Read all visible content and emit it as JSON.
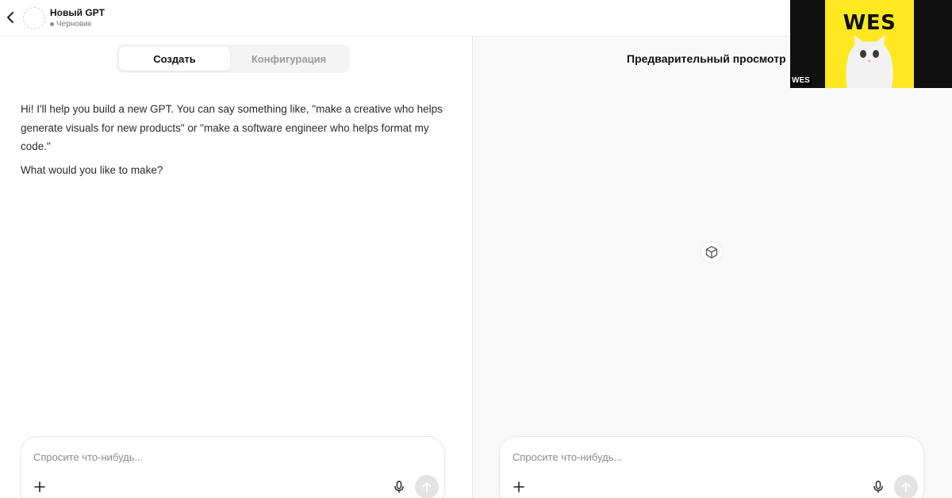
{
  "header": {
    "title": "Новый GPT",
    "status": "Черновик"
  },
  "tabs": [
    {
      "label": "Создать",
      "active": true
    },
    {
      "label": "Конфигурация",
      "active": false
    }
  ],
  "chat": {
    "messages": [
      "Hi! I'll help you build a new GPT. You can say something like, \"make a creative who helps generate visuals for new products\" or \"make a software engineer who helps format my code.\"",
      "What would you like to make?"
    ]
  },
  "composer": {
    "placeholder": "Спросите что-нибудь..."
  },
  "preview": {
    "title": "Предварительный просмотр"
  },
  "webcam": {
    "word": "WES",
    "tag": "WES",
    "accent": "#ffe81f"
  },
  "icons": [
    "chevron-left-icon",
    "plus-icon",
    "microphone-icon",
    "arrow-up-icon",
    "cube-icon"
  ],
  "colors": {
    "divider": "#e6e6e6",
    "preview_bg": "#f9f9f9",
    "send_button_bg": "#e3e3e3"
  }
}
